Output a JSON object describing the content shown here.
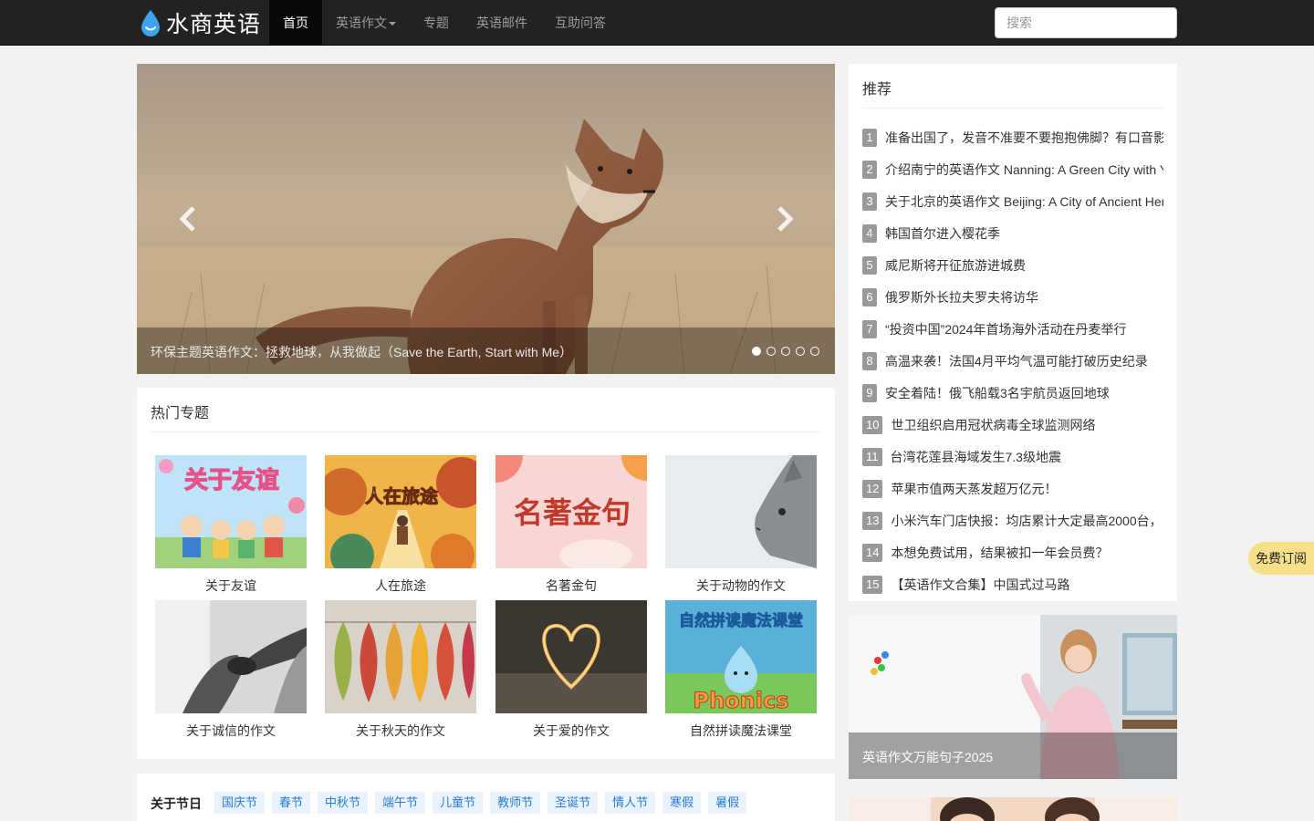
{
  "site": {
    "logo_text": "水商英语"
  },
  "nav": {
    "items": [
      {
        "label": "首页"
      },
      {
        "label": "英语作文"
      },
      {
        "label": "专题"
      },
      {
        "label": "英语邮件"
      },
      {
        "label": "互助问答"
      }
    ]
  },
  "search": {
    "placeholder": "搜索"
  },
  "carousel": {
    "caption": "环保主题英语作文：拯救地球，从我做起（Save the Earth, Start with Me）",
    "slide_count": 5,
    "active_index": 0
  },
  "hot_topics": {
    "title": "热门专题",
    "items": [
      {
        "label": "关于友谊",
        "image_text": "关于友谊"
      },
      {
        "label": "人在旅途",
        "image_text": "人在旅途"
      },
      {
        "label": "名著金句",
        "image_text": "名著金句"
      },
      {
        "label": "关于动物的作文"
      },
      {
        "label": "关于诚信的作文"
      },
      {
        "label": "关于秋天的作文"
      },
      {
        "label": "关于爱的作文"
      },
      {
        "label": "自然拼读魔法课堂",
        "image_text": "自然拼读魔法课堂",
        "image_subtext": "Phonics"
      }
    ]
  },
  "holidays": {
    "title": "关于节日",
    "tags": [
      "国庆节",
      "春节",
      "中秋节",
      "端午节",
      "儿童节",
      "教师节",
      "圣诞节",
      "情人节",
      "寒假",
      "暑假"
    ]
  },
  "recommend": {
    "title": "推荐",
    "items": [
      {
        "num": "1",
        "text": "准备出国了，发音不准要不要抱抱佛脚？有口音影"
      },
      {
        "num": "2",
        "text": "介绍南宁的英语作文 Nanning: A Green City with Y"
      },
      {
        "num": "3",
        "text": "关于北京的英语作文 Beijing: A City of Ancient Her"
      },
      {
        "num": "4",
        "text": "韩国首尔进入樱花季"
      },
      {
        "num": "5",
        "text": "威尼斯将开征旅游进城费"
      },
      {
        "num": "6",
        "text": "俄罗斯外长拉夫罗夫将访华"
      },
      {
        "num": "7",
        "text": "“投资中国”2024年首场海外活动在丹麦举行"
      },
      {
        "num": "8",
        "text": "高温来袭！法国4月平均气温可能打破历史纪录"
      },
      {
        "num": "9",
        "text": "安全着陆！俄飞船载3名宇航员返回地球"
      },
      {
        "num": "10",
        "text": "世卫组织启用冠状病毒全球监测网络"
      },
      {
        "num": "11",
        "text": "台湾花莲县海域发生7.3级地震"
      },
      {
        "num": "12",
        "text": "苹果市值两天蒸发超万亿元！"
      },
      {
        "num": "13",
        "text": "小米汽车门店快报：均店累计大定最高2000台，"
      },
      {
        "num": "14",
        "text": "本想免费试用，结果被扣一年会员费？"
      },
      {
        "num": "15",
        "text": "【英语作文合集】中国式过马路"
      }
    ]
  },
  "promo": {
    "caption": "英语作文万能句子2025"
  },
  "subscribe": {
    "label": "免费订阅"
  }
}
